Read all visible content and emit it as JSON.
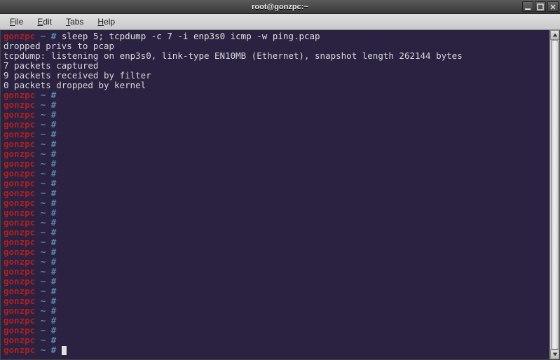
{
  "window": {
    "title": "root@gonzpc:~"
  },
  "menubar": {
    "items": [
      {
        "label": "File",
        "hotkey_pos": 0
      },
      {
        "label": "Edit",
        "hotkey_pos": 0
      },
      {
        "label": "Tabs",
        "hotkey_pos": 0
      },
      {
        "label": "Help",
        "hotkey_pos": 0
      }
    ]
  },
  "prompt": {
    "host": "gonzpc",
    "sep1": " ",
    "tilde": "~",
    "sep2": " ",
    "hash": "#"
  },
  "command": "sleep 5; tcpdump -c 7 -i enp3s0 icmp -w ping.pcap",
  "output_lines": [
    "dropped privs to pcap",
    "tcpdump: listening on enp3s0, link-type EN10MB (Ethernet), snapshot length 262144 bytes",
    "7 packets captured",
    "9 packets received by filter",
    "0 packets dropped by kernel"
  ],
  "empty_prompt_count": 27
}
